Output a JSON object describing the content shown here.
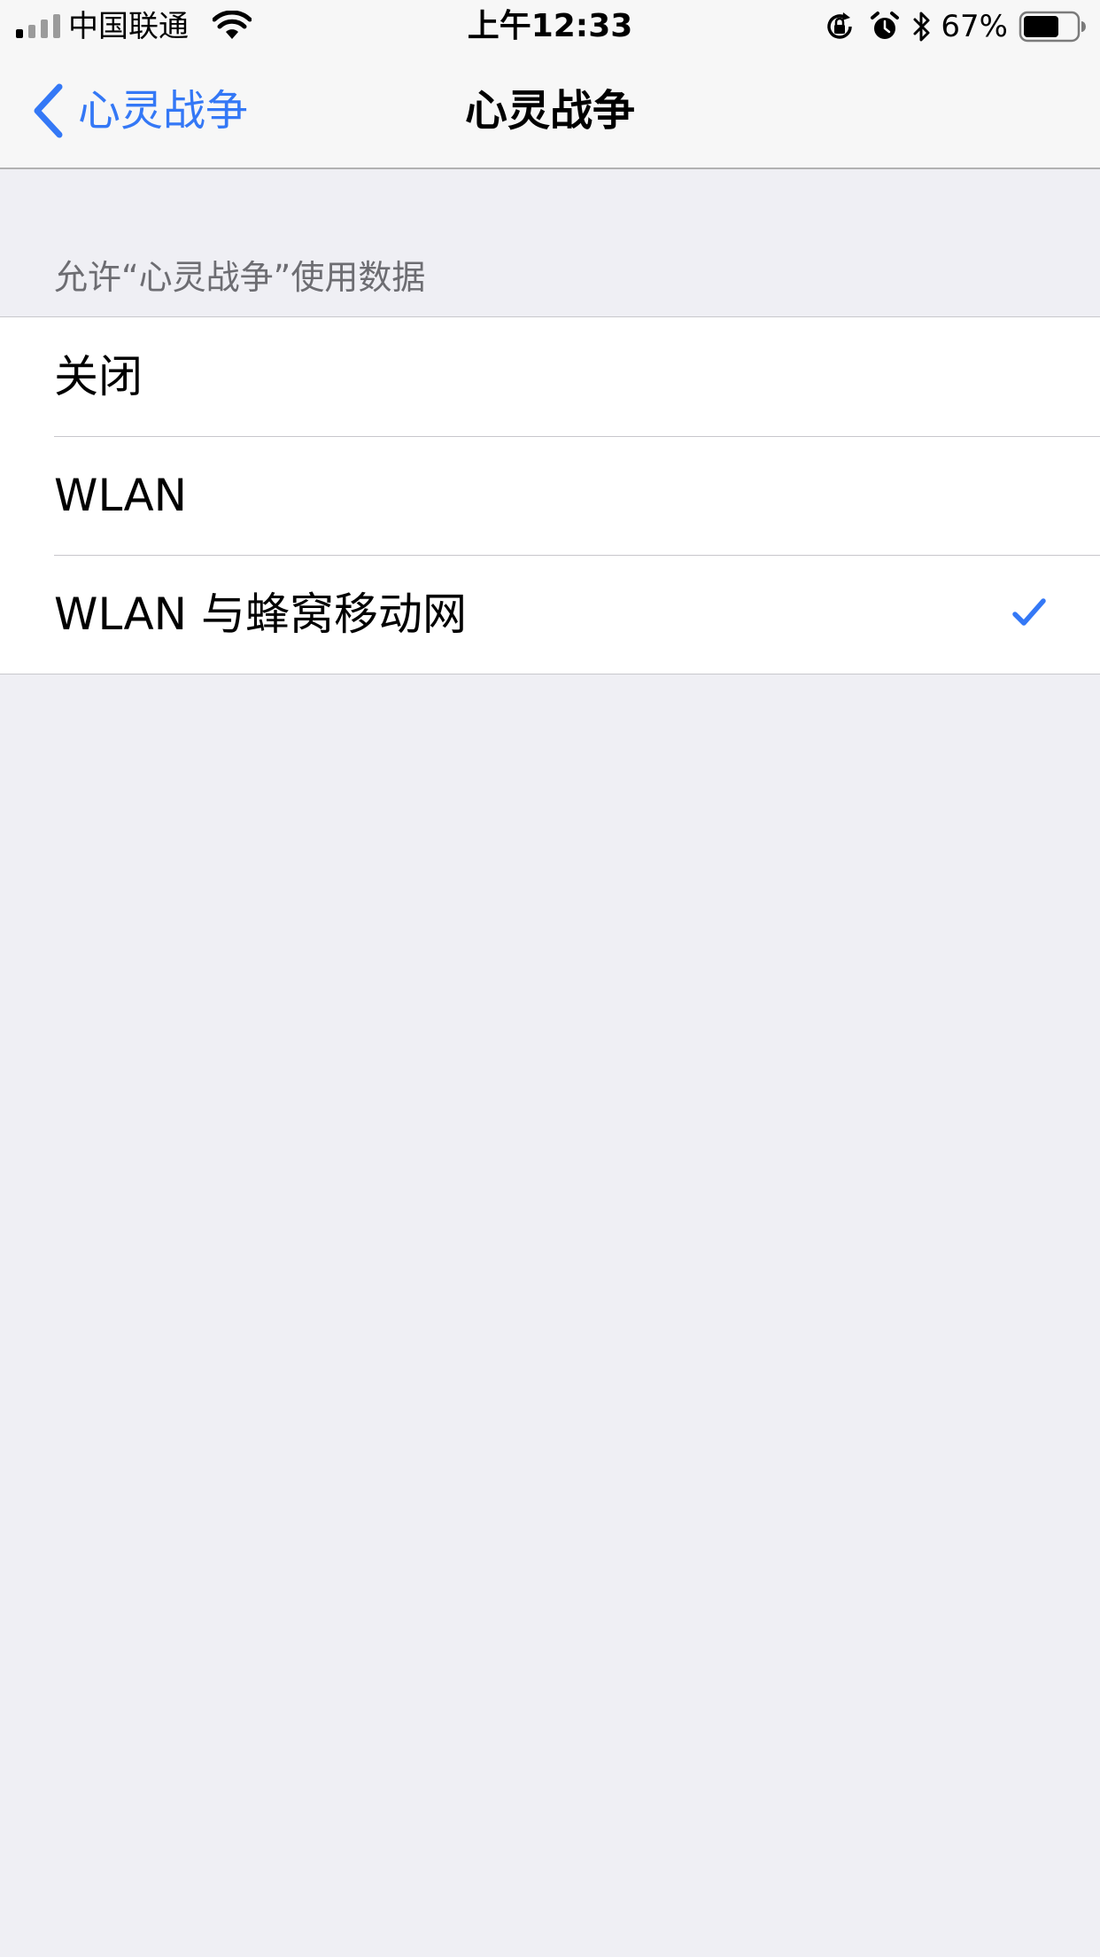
{
  "status_bar": {
    "carrier": "中国联通",
    "time": "上午12:33",
    "battery_percent": "67%",
    "battery_level": 0.67,
    "icons": [
      "signal-icon",
      "wifi-icon",
      "rotation-lock-icon",
      "alarm-icon",
      "bluetooth-icon",
      "battery-icon"
    ]
  },
  "nav": {
    "back_label": "心灵战争",
    "title": "心灵战争"
  },
  "section": {
    "header": "允许“心灵战争”使用数据",
    "options": [
      {
        "label": "关闭",
        "selected": false
      },
      {
        "label": "WLAN",
        "selected": false
      },
      {
        "label": "WLAN 与蜂窝移动网",
        "selected": true
      }
    ]
  },
  "colors": {
    "accent": "#3478f6",
    "background": "#efeff4",
    "cell": "#ffffff",
    "separator": "#c8c7cc",
    "header_text": "#6d6d72"
  }
}
